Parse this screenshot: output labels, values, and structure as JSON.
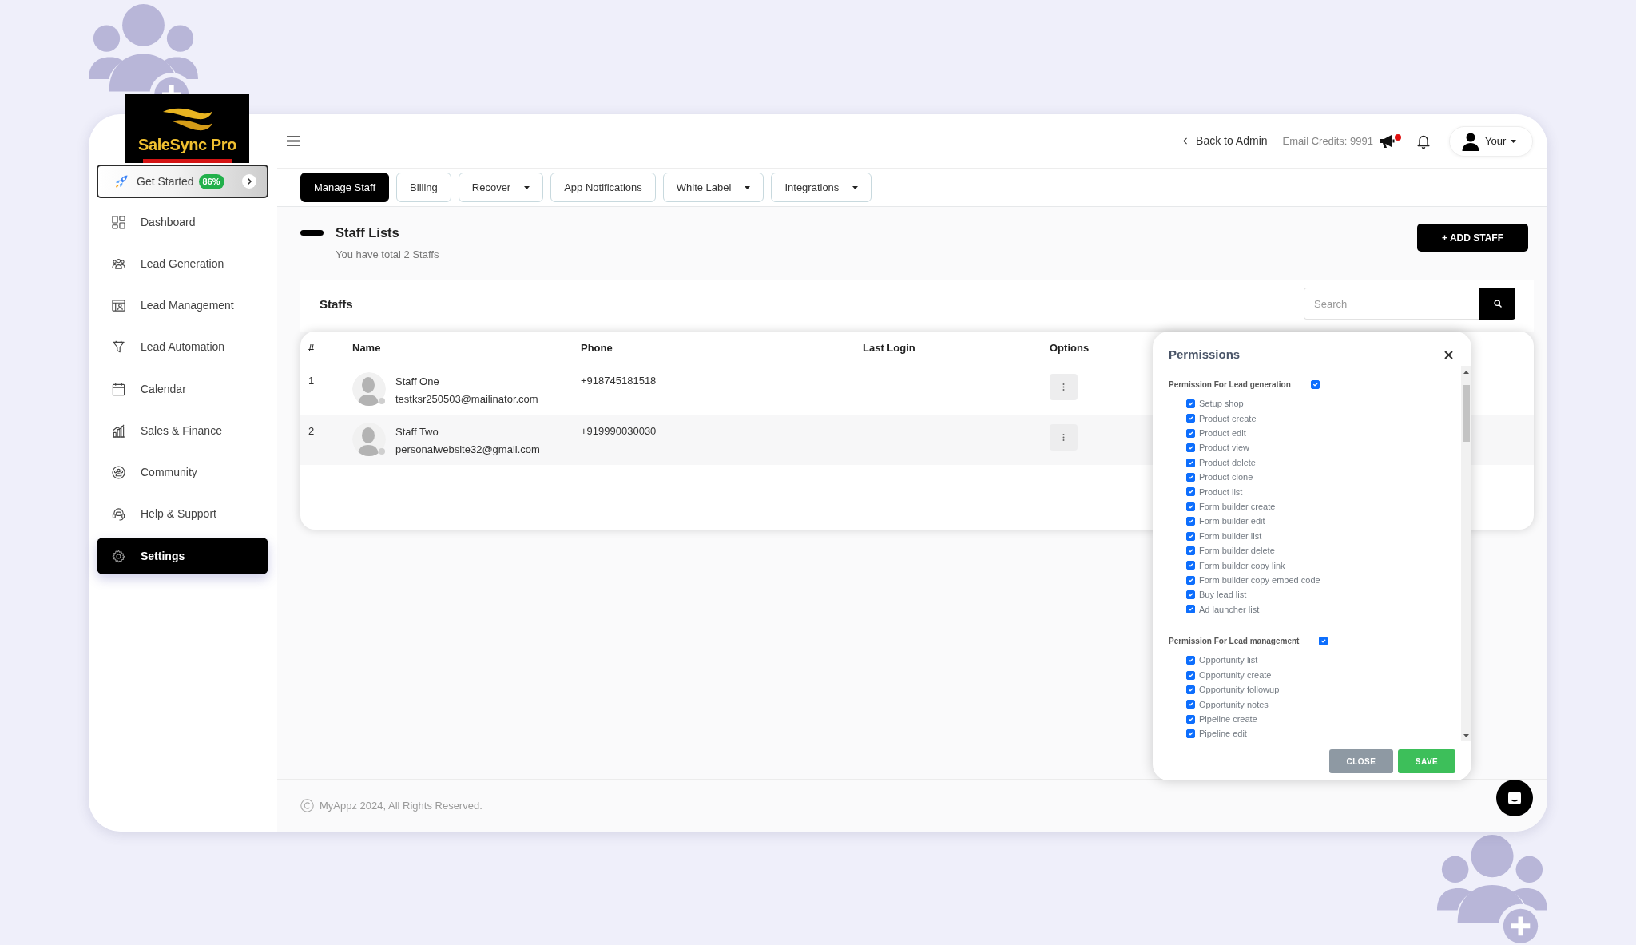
{
  "logo": {
    "text": "SaleSync Pro"
  },
  "sidebar": {
    "get_started": {
      "label": "Get Started",
      "badge": "86%"
    },
    "items": [
      {
        "label": "Dashboard",
        "selected": false
      },
      {
        "label": "Lead Generation",
        "selected": false
      },
      {
        "label": "Lead Management",
        "selected": false
      },
      {
        "label": "Lead Automation",
        "selected": false
      },
      {
        "label": "Calendar",
        "selected": false
      },
      {
        "label": "Sales & Finance",
        "selected": false
      },
      {
        "label": "Community",
        "selected": false
      },
      {
        "label": "Help & Support",
        "selected": false
      },
      {
        "label": "Settings",
        "selected": true
      }
    ]
  },
  "header": {
    "back_link": "Back to Admin",
    "email_credits": "Email Credits: 9991",
    "announcement_dot": true,
    "user": "Your"
  },
  "tabs": [
    {
      "label": "Manage Staff",
      "selected": true,
      "dropdown": false
    },
    {
      "label": "Billing",
      "selected": false,
      "dropdown": false
    },
    {
      "label": "Recover",
      "selected": false,
      "dropdown": true
    },
    {
      "label": "App Notifications",
      "selected": false,
      "dropdown": false
    },
    {
      "label": "White Label",
      "selected": false,
      "dropdown": true
    },
    {
      "label": "Integrations",
      "selected": false,
      "dropdown": true
    }
  ],
  "page": {
    "title": "Staff Lists",
    "subtitle": "You have total 2 Staffs",
    "add_button": "+ ADD STAFF"
  },
  "staffs": {
    "title": "Staffs",
    "search": {
      "placeholder": "Search"
    },
    "columns": [
      "#",
      "Name",
      "Phone",
      "Last Login",
      "Options"
    ],
    "rows": [
      {
        "index": "1",
        "name": "Staff One",
        "email": "testksr250503@mailinator.com",
        "phone": "+918745181518",
        "online": false
      },
      {
        "index": "2",
        "name": "Staff Two",
        "email": "personalwebsite32@gmail.com",
        "phone": "+919990030030",
        "online": false
      }
    ]
  },
  "permissions": {
    "title": "Permissions",
    "groups": [
      {
        "title": "Permission For Lead generation",
        "checked": true,
        "items": [
          {
            "label": "Setup shop",
            "checked": true
          },
          {
            "label": "Product create",
            "checked": true
          },
          {
            "label": "Product edit",
            "checked": true
          },
          {
            "label": "Product view",
            "checked": true
          },
          {
            "label": "Product delete",
            "checked": true
          },
          {
            "label": "Product clone",
            "checked": true
          },
          {
            "label": "Product list",
            "checked": true
          },
          {
            "label": "Form builder create",
            "checked": true
          },
          {
            "label": "Form builder edit",
            "checked": true
          },
          {
            "label": "Form builder list",
            "checked": true
          },
          {
            "label": "Form builder delete",
            "checked": true
          },
          {
            "label": "Form builder copy link",
            "checked": true
          },
          {
            "label": "Form builder copy embed code",
            "checked": true
          },
          {
            "label": "Buy lead list",
            "checked": true
          },
          {
            "label": "Ad launcher list",
            "checked": true
          }
        ]
      },
      {
        "title": "Permission For Lead management",
        "checked": true,
        "items": [
          {
            "label": "Opportunity list",
            "checked": true
          },
          {
            "label": "Opportunity create",
            "checked": true
          },
          {
            "label": "Opportunity followup",
            "checked": true
          },
          {
            "label": "Opportunity notes",
            "checked": true
          },
          {
            "label": "Pipeline create",
            "checked": true
          },
          {
            "label": "Pipeline edit",
            "checked": true
          }
        ]
      }
    ],
    "buttons": [
      {
        "label": "CLOSE",
        "kind": "secondary"
      },
      {
        "label": "SAVE",
        "kind": "primary"
      }
    ]
  },
  "footer": {
    "text": "MyAppz 2024, All Rights Reserved."
  }
}
